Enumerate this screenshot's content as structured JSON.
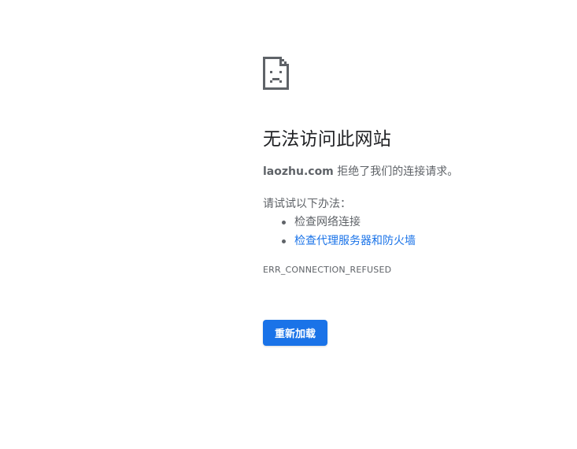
{
  "icon": "sad-page-icon",
  "title": "无法访问此网站",
  "summary": {
    "host": "laozhu.com",
    "message": " 拒绝了我们的连接请求。"
  },
  "suggestions": {
    "intro": "请试试以下办法：",
    "items": [
      {
        "label": "检查网络连接",
        "is_link": false
      },
      {
        "label": "检查代理服务器和防火墙",
        "is_link": true
      }
    ]
  },
  "error_code": "ERR_CONNECTION_REFUSED",
  "reload_button": {
    "label": "重新加载"
  },
  "colors": {
    "accent": "#1a73e8",
    "text": "#5f6368",
    "heading": "#202124"
  }
}
